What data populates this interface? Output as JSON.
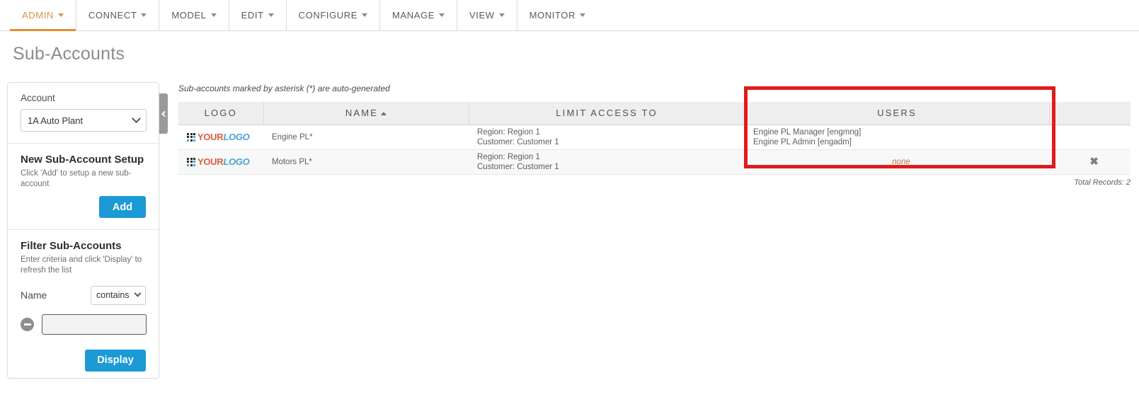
{
  "topnav": {
    "items": [
      {
        "label": "ADMIN",
        "active": true
      },
      {
        "label": "CONNECT",
        "active": false
      },
      {
        "label": "MODEL",
        "active": false
      },
      {
        "label": "EDIT",
        "active": false
      },
      {
        "label": "CONFIGURE",
        "active": false
      },
      {
        "label": "MANAGE",
        "active": false
      },
      {
        "label": "VIEW",
        "active": false
      },
      {
        "label": "MONITOR",
        "active": false
      }
    ]
  },
  "page": {
    "title": "Sub-Accounts",
    "note": "Sub-accounts marked by asterisk (*) are auto-generated"
  },
  "sidebar": {
    "account_label": "Account",
    "account_value": "1A Auto Plant",
    "new_setup_heading": "New Sub-Account Setup",
    "new_setup_sub": "Click 'Add' to setup a new sub-account",
    "add_button": "Add",
    "filter_heading": "Filter Sub-Accounts",
    "filter_sub": "Enter criteria and click 'Display' to refresh the list",
    "filter_field_label": "Name",
    "filter_operator": "contains",
    "filter_value": "",
    "filter_placeholder": "",
    "display_button": "Display"
  },
  "table": {
    "columns": [
      "LOGO",
      "NAME",
      "LIMIT ACCESS TO",
      "USERS",
      ""
    ],
    "sorted_column": "NAME",
    "sort_direction": "asc",
    "rows": [
      {
        "logo": {
          "your": "YOUR",
          "logo": "LOGO"
        },
        "name": "Engine PL*",
        "limit_region": "Region: Region 1",
        "limit_customer": "Customer: Customer 1",
        "users": [
          "Engine PL Manager [engmng]",
          "Engine PL Admin [engadm]"
        ],
        "users_none": "",
        "delete_icon": ""
      },
      {
        "logo": {
          "your": "YOUR",
          "logo": "LOGO"
        },
        "name": "Motors PL*",
        "limit_region": "Region: Region 1",
        "limit_customer": "Customer: Customer 1",
        "users": [],
        "users_none": "none",
        "delete_icon": "✖"
      }
    ],
    "total_records": "Total Records: 2"
  },
  "colors": {
    "accent_orange": "#e08f33",
    "button_blue": "#1b9ad6",
    "highlight_red": "#e01b1b",
    "logo_orange": "#d9603f",
    "logo_blue": "#4aa3dd",
    "none_text": "#b8784a"
  }
}
